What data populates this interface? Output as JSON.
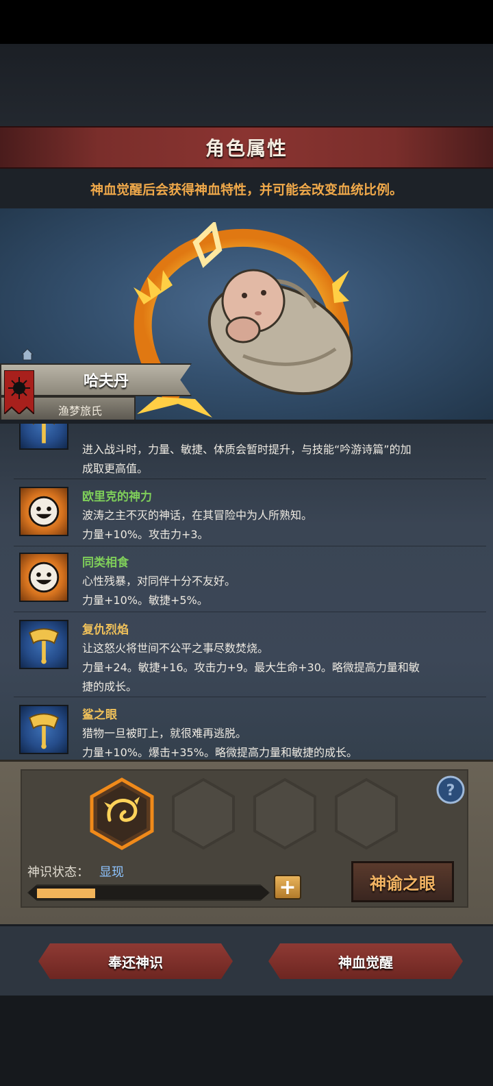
{
  "header": {
    "title": "角色属性",
    "notice": "神血觉醒后会获得神血特性，并可能会改变血统比例。"
  },
  "character": {
    "name": "哈夫丹",
    "clan": "渔梦旅氏"
  },
  "traits_partial": {
    "line1": "进入战斗时，力量、敏捷、体质会暂时提升，与技能“吟游诗篇”的加",
    "line2": "成取更高值。"
  },
  "traits": [
    {
      "icon": "smile-icon",
      "name": "欧里克的神力",
      "name_color": "#7fcf5a",
      "desc": "波涛之主不灭的神话，在其冒险中为人所熟知。",
      "effect": "力量+10%。攻击力+3。",
      "effect2": ""
    },
    {
      "icon": "smile-icon",
      "name": "同类相食",
      "name_color": "#7fcf5a",
      "desc": "心性残暴，对同伴十分不友好。",
      "effect": "力量+10%。敏捷+5%。",
      "effect2": ""
    },
    {
      "icon": "axe-icon",
      "name": "复仇烈焰",
      "name_color": "#f0c15a",
      "desc": "让这怒火将世间不公平之事尽数焚烧。",
      "effect": "力量+24。敏捷+16。攻击力+9。最大生命+30。略微提高力量和敏",
      "effect2": "捷的成长。"
    },
    {
      "icon": "axe-icon",
      "name": "鲨之眼",
      "name_color": "#f0c15a",
      "desc": "猎物一旦被盯上，就很难再逃脱。",
      "effect": "力量+10%。爆击+35%。略微提高力量和敏捷的成长。",
      "effect2": ""
    }
  ],
  "divine": {
    "status_label": "神识状态：",
    "status_value": "显现",
    "progress": 0.26,
    "plus_label": "+",
    "oracle_label": "神谕之眼",
    "help_label": "?"
  },
  "actions": {
    "return_label": "奉还神识",
    "awaken_label": "神血觉醒"
  }
}
